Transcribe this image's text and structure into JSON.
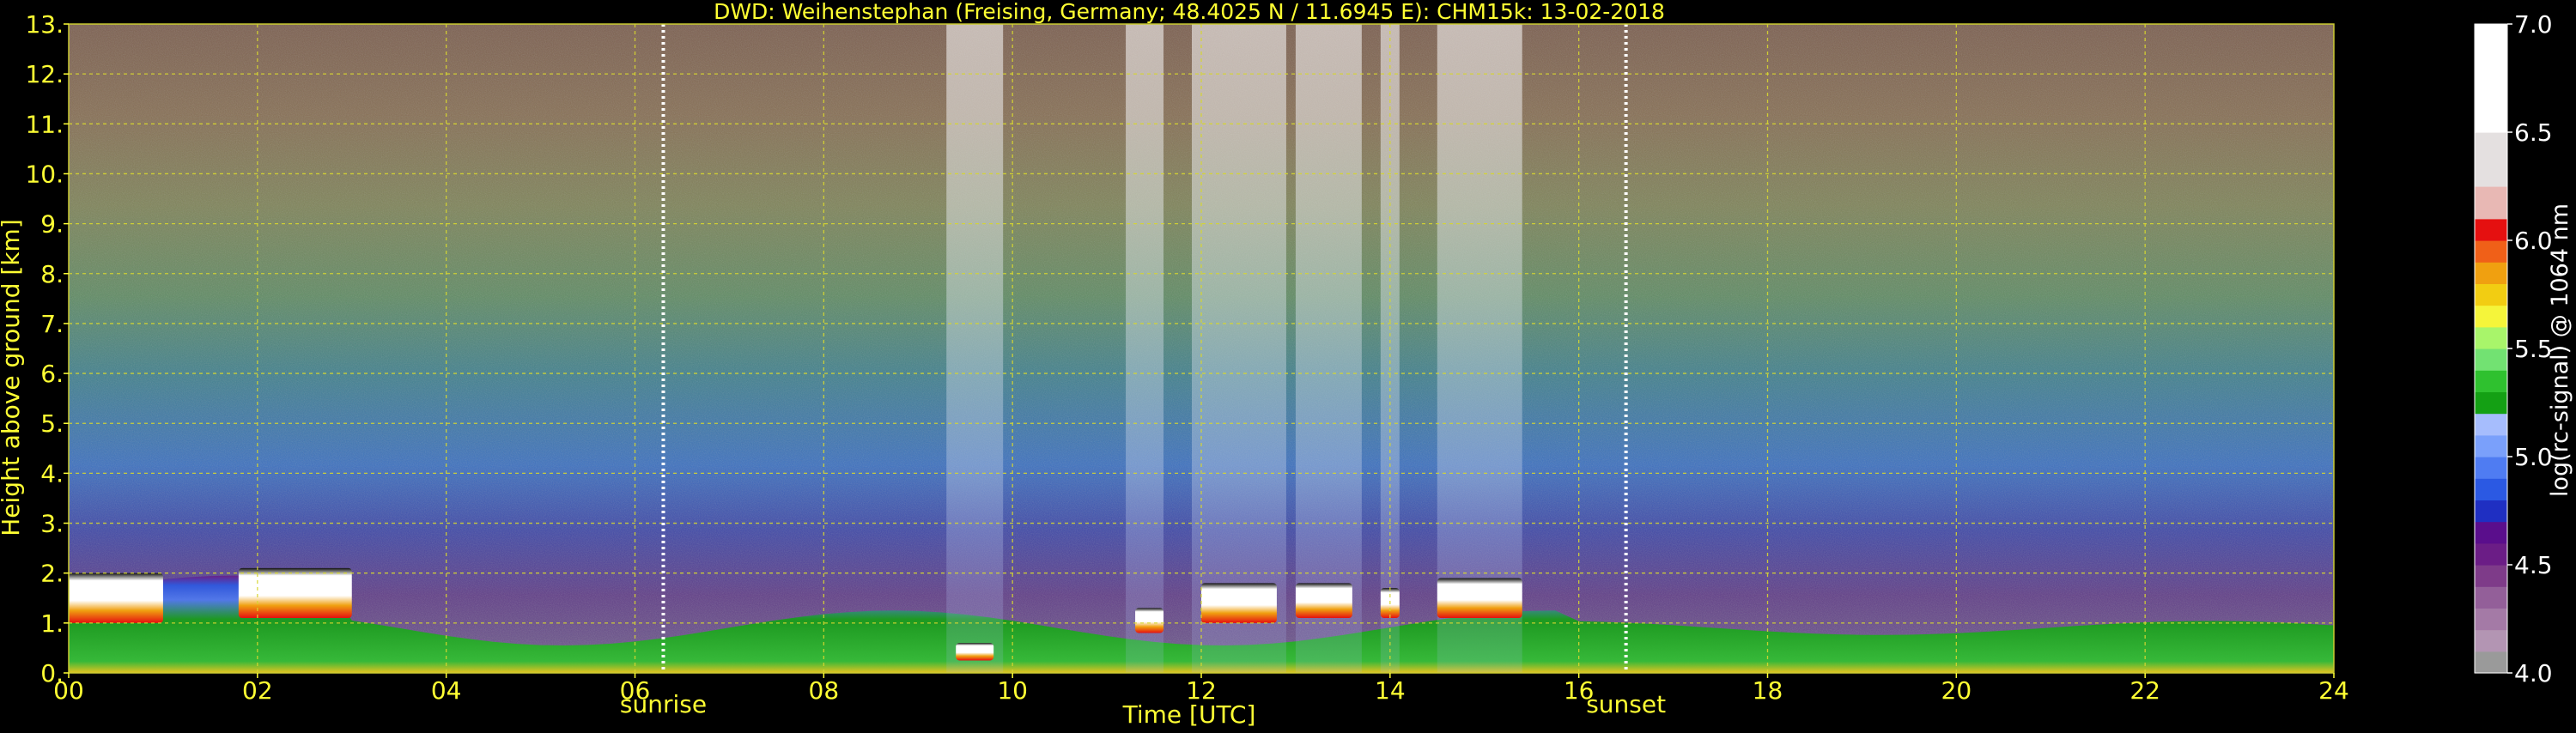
{
  "chart_data": {
    "type": "heatmap",
    "title": "DWD: Weihenstephan (Freising, Germany; 48.4025 N / 11.6945 E):    CHM15k: 13-02-2018",
    "xlabel": "Time [UTC]",
    "ylabel": "Height above ground [km]",
    "xlim": [
      0,
      24
    ],
    "ylim": [
      0,
      13
    ],
    "x_ticks": [
      {
        "value": 0,
        "label": "00"
      },
      {
        "value": 2,
        "label": "02"
      },
      {
        "value": 4,
        "label": "04"
      },
      {
        "value": 6,
        "label": "06"
      },
      {
        "value": 8,
        "label": "08"
      },
      {
        "value": 10,
        "label": "10"
      },
      {
        "value": 12,
        "label": "12"
      },
      {
        "value": 14,
        "label": "14"
      },
      {
        "value": 16,
        "label": "16"
      },
      {
        "value": 18,
        "label": "18"
      },
      {
        "value": 20,
        "label": "20"
      },
      {
        "value": 22,
        "label": "22"
      },
      {
        "value": 24,
        "label": "24"
      }
    ],
    "y_ticks": [
      {
        "value": 0,
        "label": "0."
      },
      {
        "value": 1,
        "label": "1."
      },
      {
        "value": 2,
        "label": "2."
      },
      {
        "value": 3,
        "label": "3."
      },
      {
        "value": 4,
        "label": "4."
      },
      {
        "value": 5,
        "label": "5."
      },
      {
        "value": 6,
        "label": "6."
      },
      {
        "value": 7,
        "label": "7."
      },
      {
        "value": 8,
        "label": "8."
      },
      {
        "value": 9,
        "label": "9."
      },
      {
        "value": 10,
        "label": "10."
      },
      {
        "value": 11,
        "label": "11."
      },
      {
        "value": 12,
        "label": "12."
      },
      {
        "value": 13,
        "label": "13."
      }
    ],
    "grid": true,
    "annotations": [
      {
        "x": 6.3,
        "label": "sunrise"
      },
      {
        "x": 16.5,
        "label": "sunset"
      }
    ],
    "colorbar": {
      "label": "log(rc-signal) @ 1064 nm",
      "range": [
        4.0,
        7.0
      ],
      "ticks": [
        {
          "value": 4.0,
          "label": "4.0"
        },
        {
          "value": 4.5,
          "label": "4.5"
        },
        {
          "value": 5.0,
          "label": "5.0"
        },
        {
          "value": 5.5,
          "label": "5.5"
        },
        {
          "value": 6.0,
          "label": "6.0"
        },
        {
          "value": 6.5,
          "label": "6.5"
        },
        {
          "value": 7.0,
          "label": "7.0"
        }
      ],
      "bands": [
        {
          "from": 4.0,
          "to": 4.1,
          "color": "#9a9a9a"
        },
        {
          "from": 4.1,
          "to": 4.2,
          "color": "#b395b3"
        },
        {
          "from": 4.2,
          "to": 4.3,
          "color": "#a47aa6"
        },
        {
          "from": 4.3,
          "to": 4.4,
          "color": "#935f99"
        },
        {
          "from": 4.4,
          "to": 4.5,
          "color": "#7e3b89"
        },
        {
          "from": 4.5,
          "to": 4.6,
          "color": "#6b1d86"
        },
        {
          "from": 4.6,
          "to": 4.7,
          "color": "#5a0e8c"
        },
        {
          "from": 4.7,
          "to": 4.8,
          "color": "#1f2fc2"
        },
        {
          "from": 4.8,
          "to": 4.9,
          "color": "#2b59e3"
        },
        {
          "from": 4.9,
          "to": 5.0,
          "color": "#4f7cf2"
        },
        {
          "from": 5.0,
          "to": 5.1,
          "color": "#7aa0fb"
        },
        {
          "from": 5.1,
          "to": 5.2,
          "color": "#a6bdfd"
        },
        {
          "from": 5.2,
          "to": 5.3,
          "color": "#14a014"
        },
        {
          "from": 5.3,
          "to": 5.4,
          "color": "#2fc12f"
        },
        {
          "from": 5.4,
          "to": 5.5,
          "color": "#72e272"
        },
        {
          "from": 5.5,
          "to": 5.6,
          "color": "#a8f56a"
        },
        {
          "from": 5.6,
          "to": 5.7,
          "color": "#f5f53a"
        },
        {
          "from": 5.7,
          "to": 5.8,
          "color": "#f2cd12"
        },
        {
          "from": 5.8,
          "to": 5.9,
          "color": "#f0a010"
        },
        {
          "from": 5.9,
          "to": 6.0,
          "color": "#f06018"
        },
        {
          "from": 6.0,
          "to": 6.1,
          "color": "#e51010"
        },
        {
          "from": 6.1,
          "to": 6.25,
          "color": "#e8b8b4"
        },
        {
          "from": 6.25,
          "to": 6.5,
          "color": "#e4e0e0"
        },
        {
          "from": 6.5,
          "to": 7.0,
          "color": "#ffffff"
        }
      ]
    },
    "cloud_events": [
      {
        "start": 0.0,
        "end": 1.0,
        "base": 1.0,
        "top": 2.0
      },
      {
        "start": 1.8,
        "end": 3.0,
        "base": 1.1,
        "top": 2.1
      },
      {
        "start": 9.4,
        "end": 9.8,
        "base": 0.25,
        "top": 0.6
      },
      {
        "start": 11.3,
        "end": 11.6,
        "base": 0.8,
        "top": 1.3
      },
      {
        "start": 12.0,
        "end": 12.8,
        "base": 1.0,
        "top": 1.8
      },
      {
        "start": 13.0,
        "end": 13.6,
        "base": 1.1,
        "top": 1.8
      },
      {
        "start": 13.9,
        "end": 14.1,
        "base": 1.1,
        "top": 1.7
      },
      {
        "start": 14.5,
        "end": 15.4,
        "base": 1.1,
        "top": 1.9
      }
    ],
    "precip_columns": [
      {
        "start": 9.3,
        "end": 9.9
      },
      {
        "start": 11.2,
        "end": 11.6
      },
      {
        "start": 11.9,
        "end": 12.9
      },
      {
        "start": 13.0,
        "end": 13.7
      },
      {
        "start": 13.9,
        "end": 14.1
      },
      {
        "start": 14.5,
        "end": 15.4
      }
    ]
  }
}
